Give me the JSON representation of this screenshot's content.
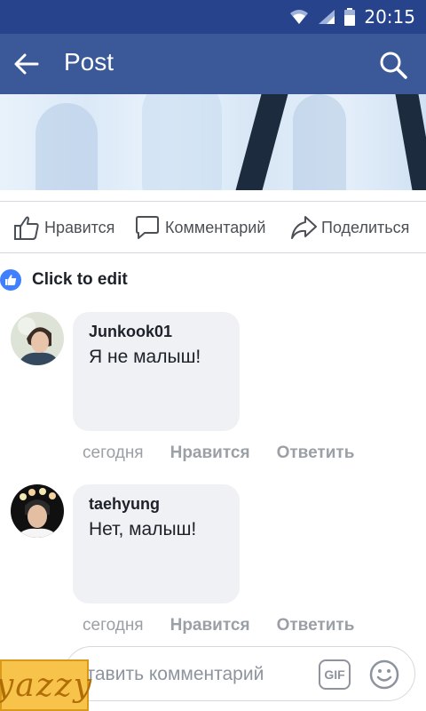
{
  "status": {
    "time": "20:15"
  },
  "header": {
    "title": "Post"
  },
  "actions": {
    "like_label": "Нравится",
    "comment_label": "Комментарий",
    "share_label": "Поделиться"
  },
  "likes": {
    "text": "Click to edit"
  },
  "comments": [
    {
      "author": "Junkook01",
      "text": "Я не малыш!",
      "time": "сегодня",
      "like_label": "Нравится",
      "reply_label": "Ответить"
    },
    {
      "author": "taehyung",
      "text": "Нет, малыш!",
      "time": "сегодня",
      "like_label": "Нравится",
      "reply_label": "Ответить"
    }
  ],
  "composer": {
    "placeholder": "ставить комментарий",
    "gif_label": "GIF"
  },
  "watermark": {
    "text": "yazzy"
  },
  "colors": {
    "status_bar": "#26438c",
    "app_bar": "#3b5998",
    "like_blue": "#4080ff"
  }
}
